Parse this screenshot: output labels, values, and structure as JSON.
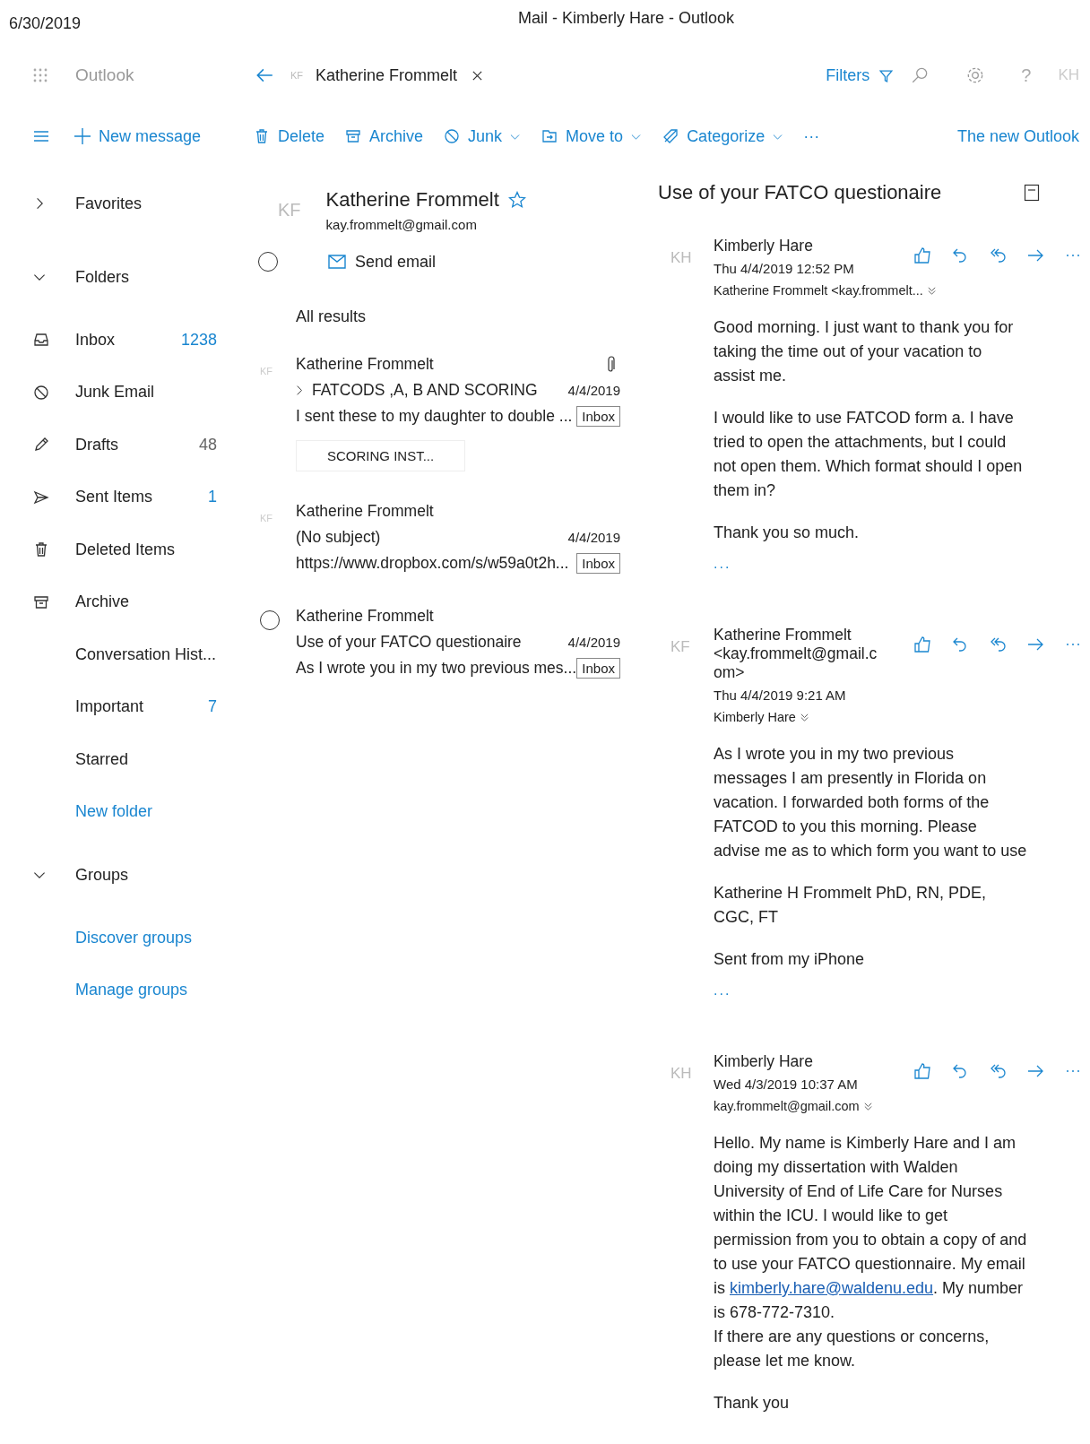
{
  "print_header": {
    "date": "6/30/2019",
    "title": "Mail - Kimberly Hare - Outlook"
  },
  "app": {
    "name": "Outlook",
    "new_message": "New message"
  },
  "search_bar": {
    "avatar": "KF",
    "query": "Katherine Frommelt",
    "filters": "Filters",
    "help": "?",
    "account": "KH"
  },
  "toolbar": [
    {
      "label": "Delete",
      "kind": "delete",
      "dropdown": false
    },
    {
      "label": "Archive",
      "kind": "archive",
      "dropdown": false
    },
    {
      "label": "Junk",
      "kind": "junk",
      "dropdown": true
    },
    {
      "label": "Move to",
      "kind": "move",
      "dropdown": true
    },
    {
      "label": "Categorize",
      "kind": "categorize",
      "dropdown": true
    },
    {
      "label": "···",
      "kind": "more",
      "dropdown": false
    }
  ],
  "new_outlook": "The new Outlook",
  "sidebar": {
    "sections": [
      {
        "label": "Favorites",
        "expanded": false
      },
      {
        "label": "Folders",
        "expanded": true,
        "items": [
          {
            "label": "Inbox",
            "kind": "inbox",
            "count": "1238",
            "highlighted": true
          },
          {
            "label": "Junk Email",
            "kind": "junk"
          },
          {
            "label": "Drafts",
            "kind": "drafts",
            "count": "48",
            "highlighted": false
          },
          {
            "label": "Sent Items",
            "kind": "sent",
            "count": "1",
            "highlighted": true
          },
          {
            "label": "Deleted Items",
            "kind": "deleted"
          },
          {
            "label": "Archive",
            "kind": "archive"
          },
          {
            "label": "Conversation Hist...",
            "kind": "folder"
          },
          {
            "label": "Important",
            "kind": "folder",
            "count": "7",
            "highlighted": true
          },
          {
            "label": "Starred",
            "kind": "folder"
          },
          {
            "label": "New folder",
            "kind": "link"
          }
        ]
      },
      {
        "label": "Groups",
        "expanded": true,
        "items": [
          {
            "label": "Discover groups",
            "kind": "link"
          },
          {
            "label": "Manage groups",
            "kind": "link"
          }
        ]
      }
    ]
  },
  "contact": {
    "avatar": "KF",
    "name": "Katherine Frommelt",
    "favorite": true,
    "email": "kay.frommelt@gmail.com",
    "selection_circle": true,
    "send_email": "Send email"
  },
  "results": {
    "heading": "All results",
    "items": [
      {
        "avatar": "KF",
        "selection_circle": false,
        "sender": "Katherine Frommelt",
        "thread_collapsed": true,
        "subject": "FATCODS ,A, B AND SCORING",
        "date": "4/4/2019",
        "preview": "I sent these to my daughter to double ...",
        "folder": "Inbox",
        "attachment": true,
        "attachment_chip": "SCORING INST..."
      },
      {
        "avatar": "KF",
        "selection_circle": false,
        "sender": "Katherine Frommelt",
        "thread_collapsed": false,
        "subject": "(No subject)",
        "date": "4/4/2019",
        "preview": "https://www.dropbox.com/s/w59a0t2h...",
        "folder": "Inbox",
        "attachment": false
      },
      {
        "selection_circle": true,
        "sender": "Katherine Frommelt",
        "thread_collapsed": false,
        "subject": "Use of your FATCO questionaire",
        "date": "4/4/2019",
        "preview": "As I wrote you in my two previous mes...",
        "folder": "Inbox",
        "attachment": false
      }
    ]
  },
  "reading_pane": {
    "subject": "Use of your FATCO questionaire",
    "messages": [
      {
        "avatar": "KH",
        "sender": "Kimberly Hare",
        "date": "Thu 4/4/2019 12:52 PM",
        "to": "Katherine Frommelt <kay.frommelt...",
        "show_more": "...",
        "body": [
          {
            "kind": "text",
            "text": "Good morning.  I just want to thank you for taking the time out of your vacation to assist me."
          },
          {
            "kind": "text",
            "text": "I would like to use FATCOD form a.  I have tried to open the attachments, but I could not open them.  Which format should I open them in?"
          },
          {
            "kind": "text",
            "text": "Thank you so much."
          }
        ]
      },
      {
        "avatar": "KF",
        "sender": "Katherine Frommelt <kay.frommelt@gmail.com>",
        "date": "Thu 4/4/2019 9:21 AM",
        "to": "Kimberly Hare",
        "show_more": "...",
        "body": [
          {
            "kind": "text",
            "text": "As I wrote you in my two previous messages I am presently in Florida on vacation. I forwarded both forms of the FATCOD to you this morning. Please advise me as to which form you want to use"
          },
          {
            "kind": "text",
            "text": "Katherine H Frommelt PhD, RN, PDE, CGC, FT"
          },
          {
            "kind": "text",
            "text": "Sent from my iPhone"
          }
        ]
      },
      {
        "avatar": "KH",
        "sender": "Kimberly Hare",
        "date": "Wed 4/3/2019 10:37 AM",
        "to": "kay.frommelt@gmail.com",
        "body": [
          {
            "kind": "link",
            "before": "Hello. My name is Kimberly Hare and I am doing my dissertation with Walden University of End of Life Care for Nurses within the ICU. I would like to get permission from you to obtain a copy of and to use your FATCO questionnaire. My email is ",
            "link": "kimberly.hare@waldenu.edu",
            "after": ". My number is 678-772-7310.",
            "continued": "If there are any questions or concerns, please let me know."
          },
          {
            "kind": "text",
            "text": "Thank you"
          }
        ]
      }
    ]
  }
}
